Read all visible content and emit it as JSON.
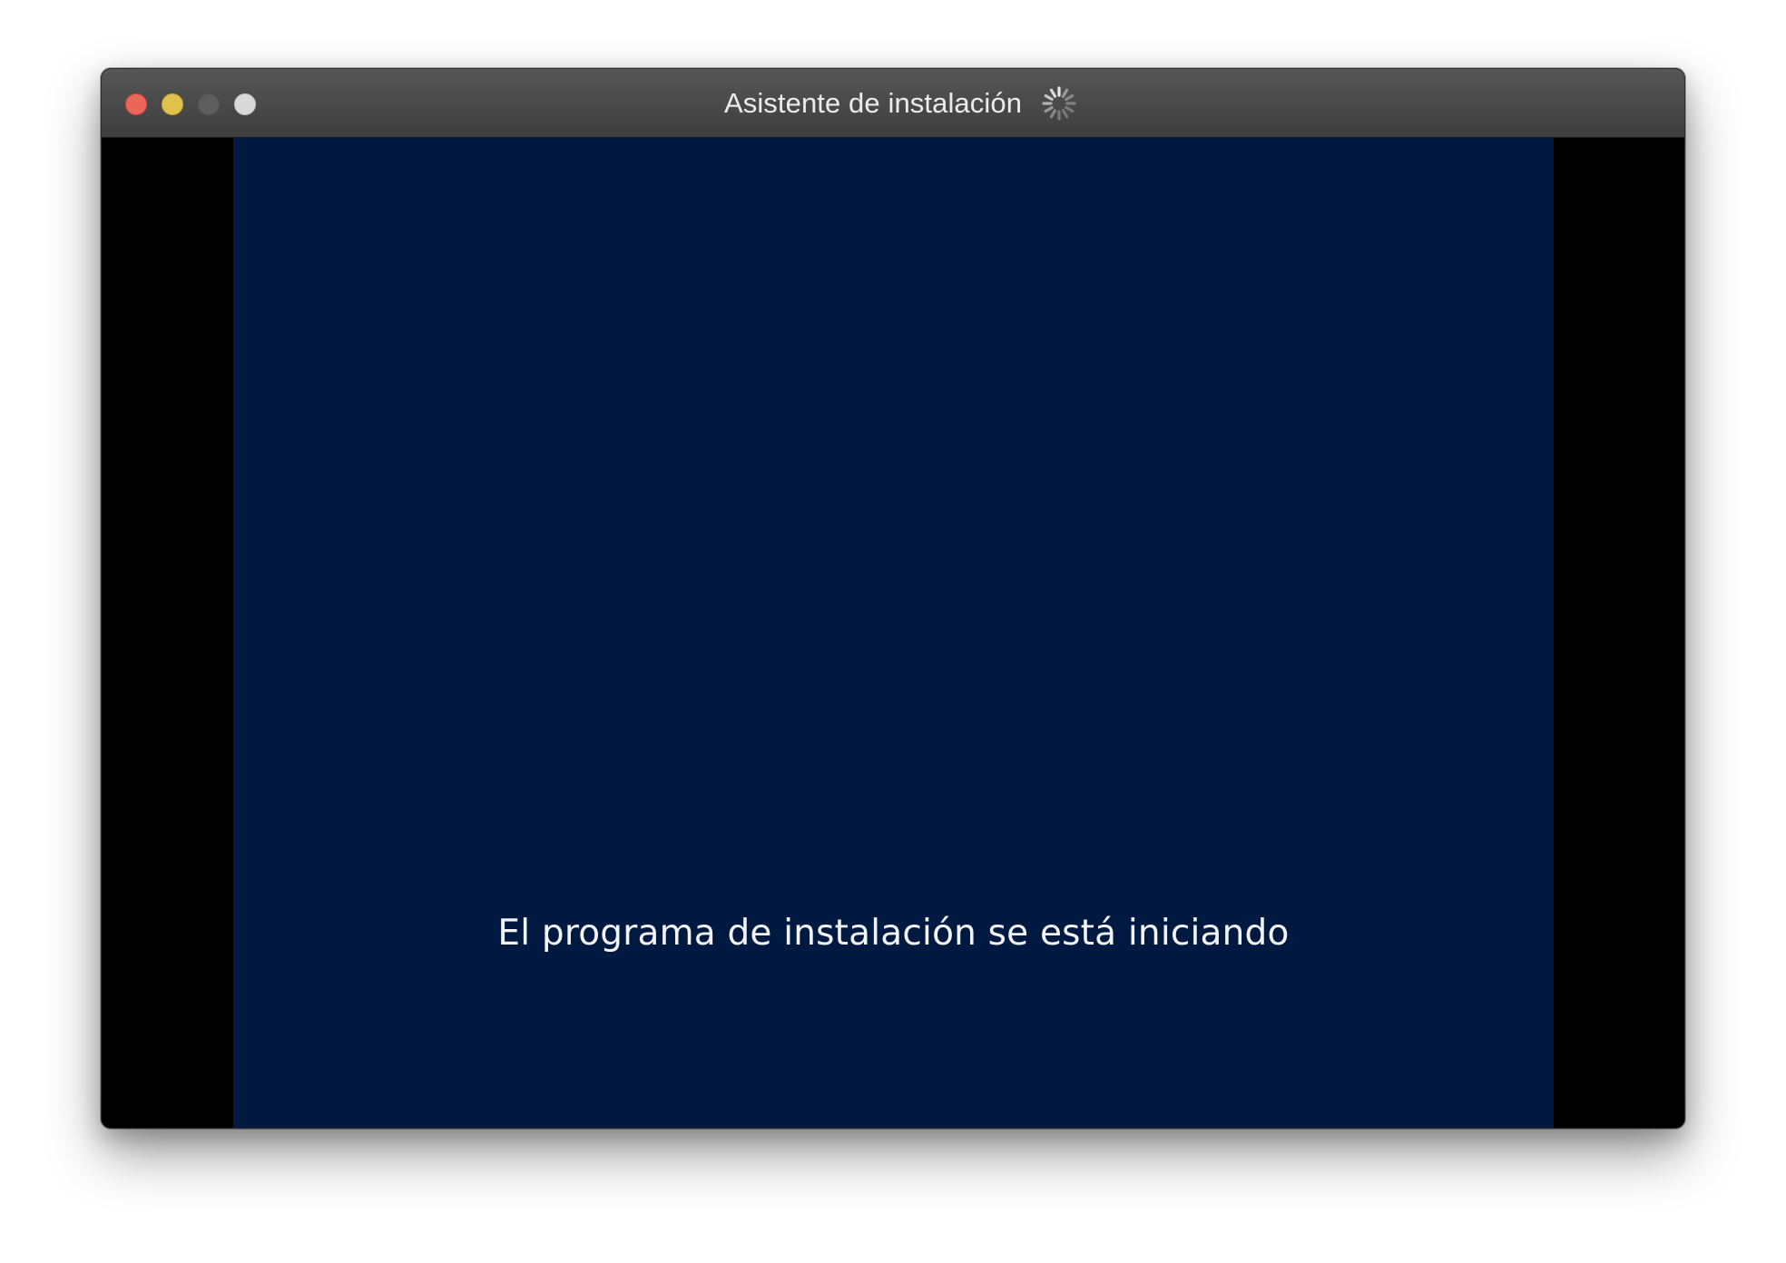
{
  "window": {
    "title": "Asistente de instalación",
    "spinner_icon": "loading-spinner-icon",
    "buttons": [
      {
        "name": "close",
        "color": "#ec6559"
      },
      {
        "name": "minimize",
        "color": "#e0c14c"
      },
      {
        "name": "zoom",
        "color": "#5e5e5e"
      },
      {
        "name": "fullscreen",
        "color": "#d9d9d9"
      }
    ]
  },
  "screen": {
    "background": "#001941",
    "status_text": "El programa de instalación se está iniciando"
  }
}
